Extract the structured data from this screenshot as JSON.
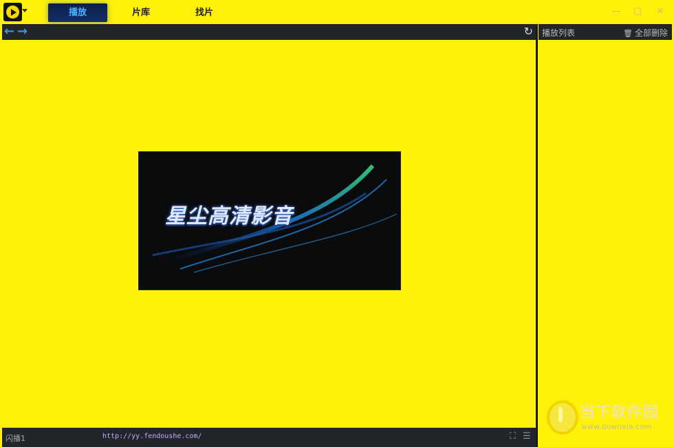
{
  "tabs": [
    {
      "label": "播放",
      "active": true
    },
    {
      "label": "片库",
      "active": false
    },
    {
      "label": "找片",
      "active": false
    }
  ],
  "window_controls": {
    "minimize": "—",
    "maximize": "□",
    "close": "✕"
  },
  "toolbar": {
    "back_icon": "arrow-left-icon",
    "forward_icon": "arrow-right-icon",
    "refresh_icon": "refresh-icon"
  },
  "playlist": {
    "title": "播放列表",
    "clear_all": "全部删除"
  },
  "player": {
    "splash_title": "星尘高清影音"
  },
  "statusbar": {
    "status": "闪播1",
    "url": "http://yy.fendoushe.com/"
  },
  "watermark": {
    "name": "当下软件园",
    "url": "www.downxia.com"
  },
  "colors": {
    "background": "#fff10a",
    "bar": "#22252a",
    "tab_active_text": "#4db2ff",
    "arrow": "#4a93d8"
  }
}
